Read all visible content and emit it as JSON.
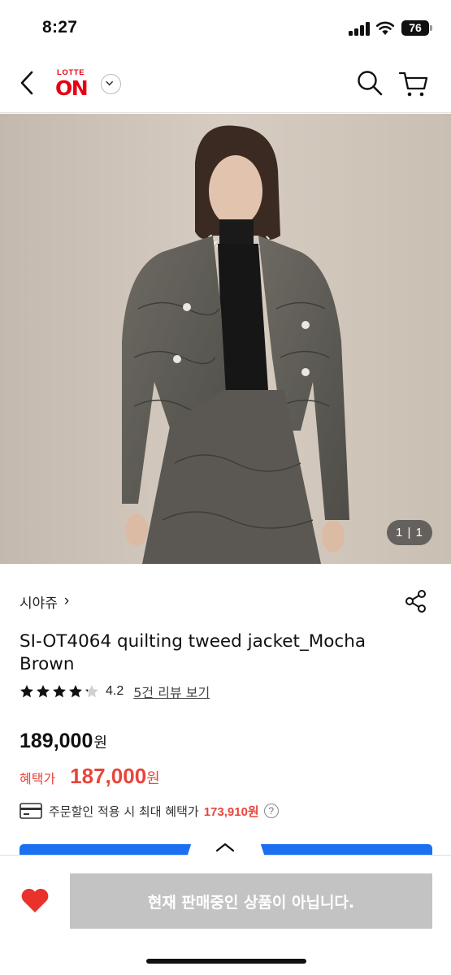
{
  "status_bar": {
    "time": "8:27",
    "battery": "76",
    "icons": [
      "signal-icon",
      "wifi-icon",
      "battery-icon"
    ]
  },
  "header": {
    "logo_top": "LOTTE",
    "logo_main": "ON",
    "icons": [
      "back-arrow-icon",
      "chevron-down-icon",
      "search-icon",
      "cart-icon"
    ]
  },
  "gallery": {
    "counter": "1 | 1"
  },
  "product": {
    "brand": "시야쥬",
    "brand_chevron": "›",
    "title": "SI-OT4064 quilting tweed jacket_Mocha Brown",
    "rating": "4.2",
    "rating_fraction": 0.84,
    "stars_total": 5,
    "review_link": "5건 리뷰 보기",
    "price": "189,000",
    "price_unit": "원",
    "benefit_label": "혜택가",
    "benefit_price": "187,000",
    "benefit_unit": "원",
    "coupon_text": "주문할인 적용 시 최대 혜택가",
    "coupon_price": "173,910원",
    "help": "?"
  },
  "bottom_bar": {
    "buy_label": "현재 판매중인 상품이 아닙니다.",
    "buy_disabled": true
  },
  "colors": {
    "brand_red": "#e60012",
    "sale_red": "#e8453c",
    "accent_blue": "#1b6ff0",
    "disabled_gray": "#c3c3c3",
    "heart_red": "#e8322b"
  }
}
